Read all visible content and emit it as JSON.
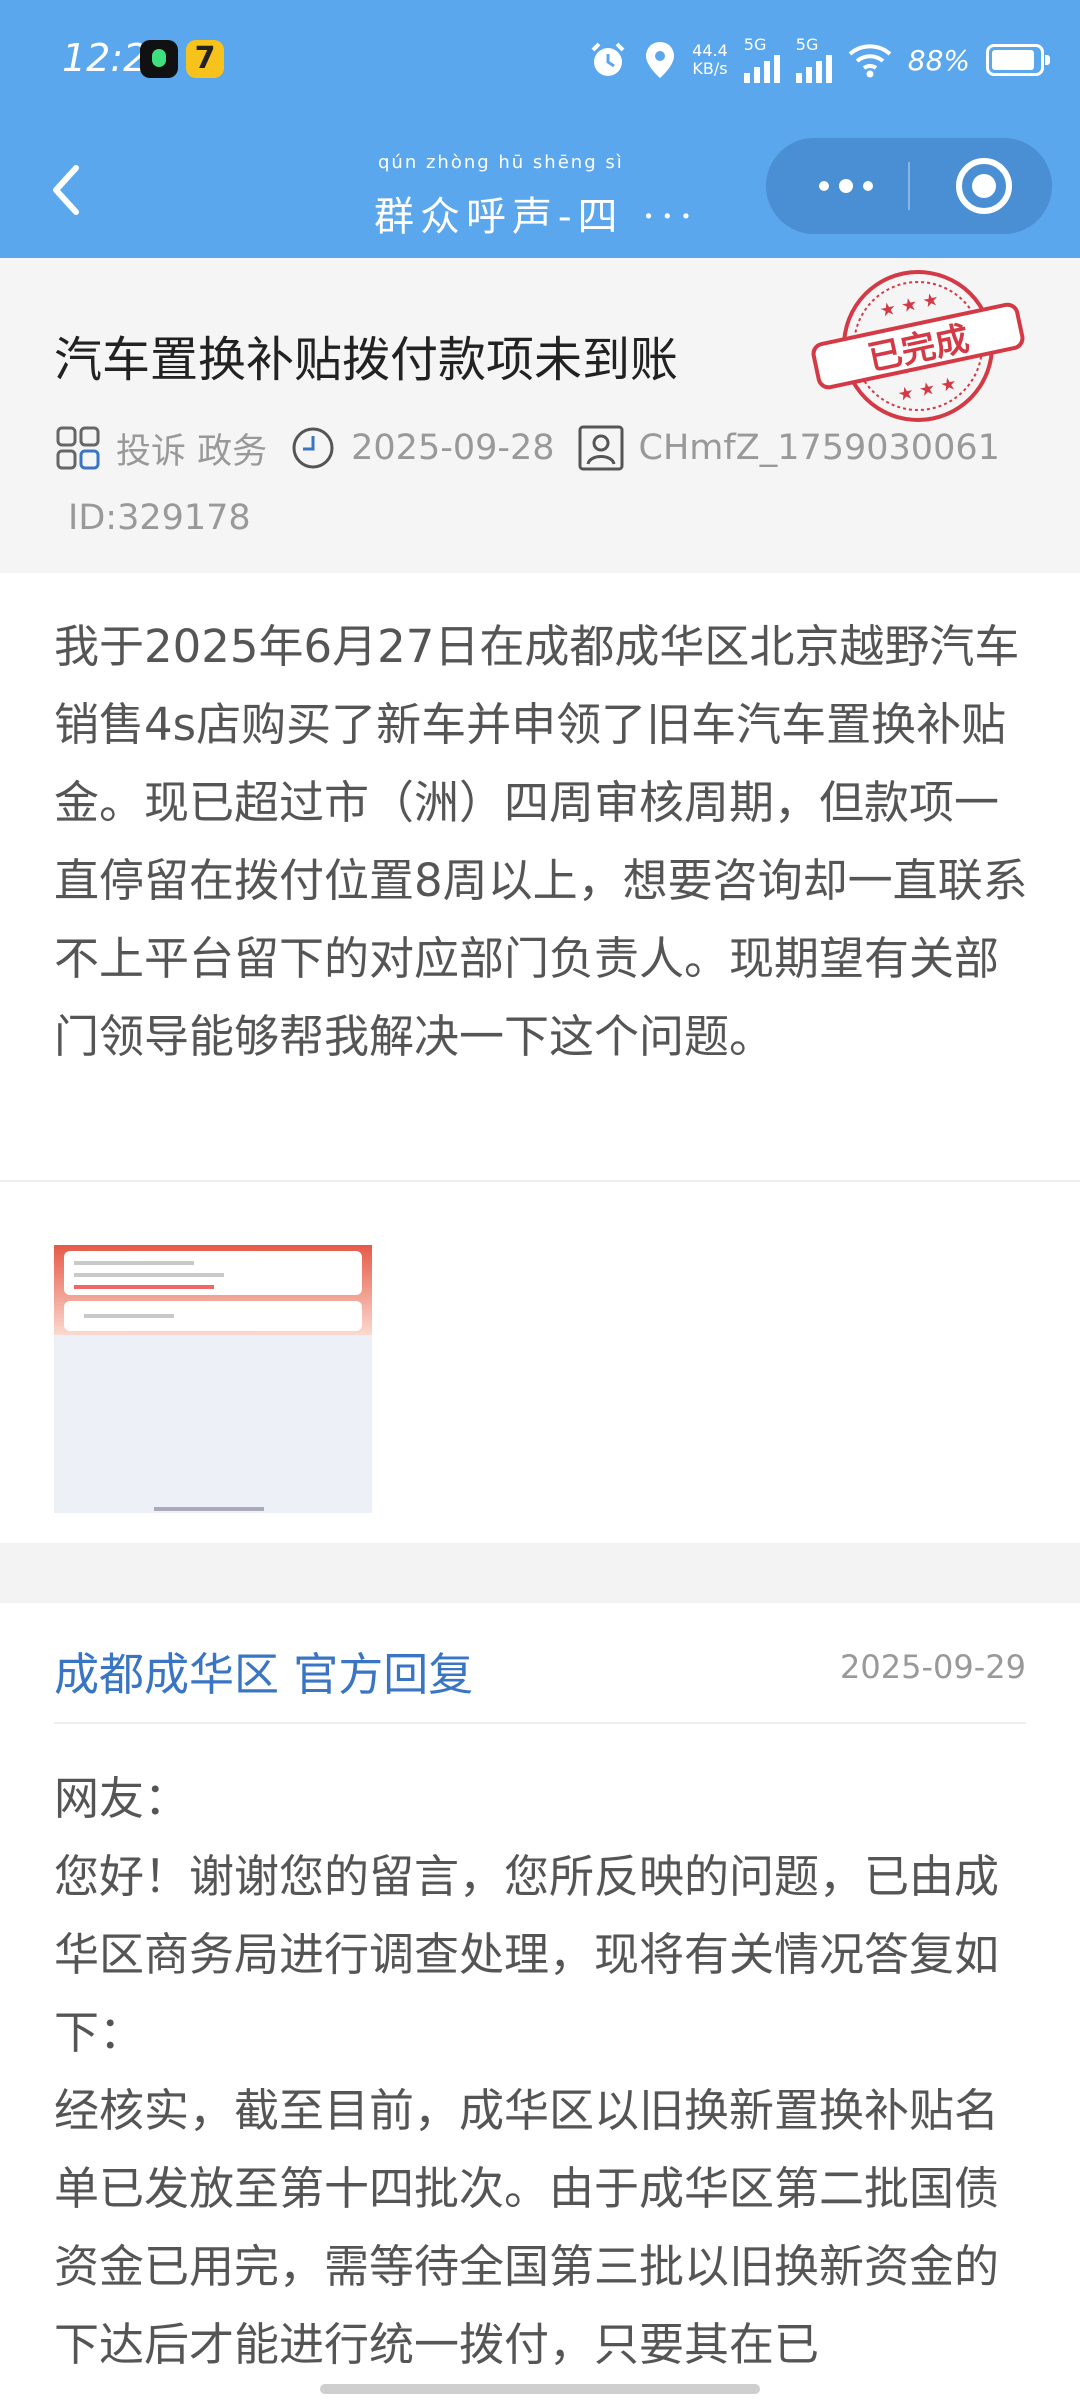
{
  "status_bar": {
    "time": "12:22",
    "net_speed_value": "44.4",
    "net_speed_unit": "KB/s",
    "signal1_label": "5G",
    "signal2_label": "5G",
    "battery": "88%"
  },
  "title_bar": {
    "brand_pinyin": "qún zhòng hū shēng sì",
    "brand_name": "群众呼声-四",
    "brand_ellipsis": "···"
  },
  "post": {
    "title": "汽车置换补贴拨付款项未到账",
    "stamp": "已完成",
    "category": "投诉 政务",
    "date": "2025-09-28",
    "user": "CHmfZ_1759030061",
    "id": "ID:329178",
    "body": "我于2025年6月27日在成都成华区北京越野汽车销售4s店购买了新车并申领了旧车汽车置换补贴金。现已超过市（洲）四周审核周期，但款项一直停留在拨付位置8周以上，想要咨询却一直联系不上平台留下的对应部门负责人。现期望有关部门领导能够帮我解决一下这个问题。"
  },
  "reply": {
    "author": "成都成华区 官方回复",
    "date": "2025-09-29",
    "greeting": "网友：",
    "para1": "您好！谢谢您的留言，您所反映的问题，已由成华区商务局进行调查处理，现将有关情况答复如下：",
    "para2": "经核实，截至目前，成华区以旧换新置换补贴名单已发放至第十四批次。由于成华区第二批国债资金已用完，需等待全国第三批以旧换新资金的下达后才能进行统一拨付，只要其在已"
  },
  "colors": {
    "header_blue": "#5aa7ed",
    "capsule_blue": "#4a8ed3",
    "reply_author_blue": "#3a75c4",
    "stamp_red": "#d33a45"
  },
  "icons": {
    "back": "chevron-left-icon",
    "more": "more-dots-icon",
    "close": "target-close-icon",
    "category": "grid-icon",
    "date": "clock-icon",
    "user": "user-icon"
  }
}
